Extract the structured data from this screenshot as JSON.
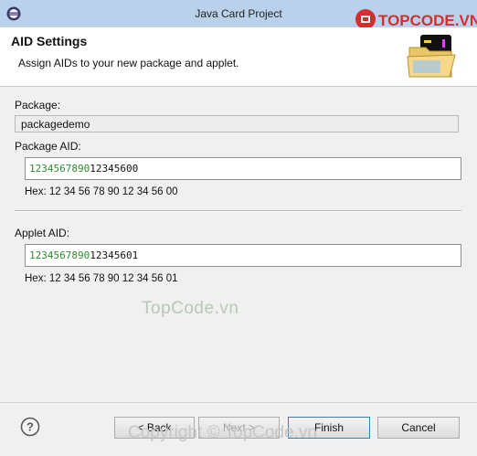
{
  "window": {
    "title": "Java Card Project"
  },
  "watermark": {
    "logo_text": "TOPCODE.VN",
    "center_text": "TopCode.vn",
    "footer_text": "Copyright © TopCode.vn"
  },
  "header": {
    "title": "AID Settings",
    "description": "Assign AIDs to your new package and applet."
  },
  "package": {
    "label": "Package:",
    "value": "packagedemo",
    "aid_label": "Package AID:",
    "aid_prefix": "1234567890",
    "aid_suffix": "12345600",
    "hex": "Hex: 12 34 56 78 90 12 34 56 00"
  },
  "applet": {
    "aid_label": "Applet AID:",
    "aid_prefix": "1234567890",
    "aid_suffix": "12345601",
    "hex": "Hex: 12 34 56 78 90 12 34 56 01"
  },
  "footer": {
    "help": "?",
    "back": "< Back",
    "next": "Next >",
    "finish": "Finish",
    "cancel": "Cancel"
  },
  "colors": {
    "titlebar": "#b9d1ea",
    "aid_highlight": "#2e8b2e",
    "logo_red": "#d32f2f"
  }
}
